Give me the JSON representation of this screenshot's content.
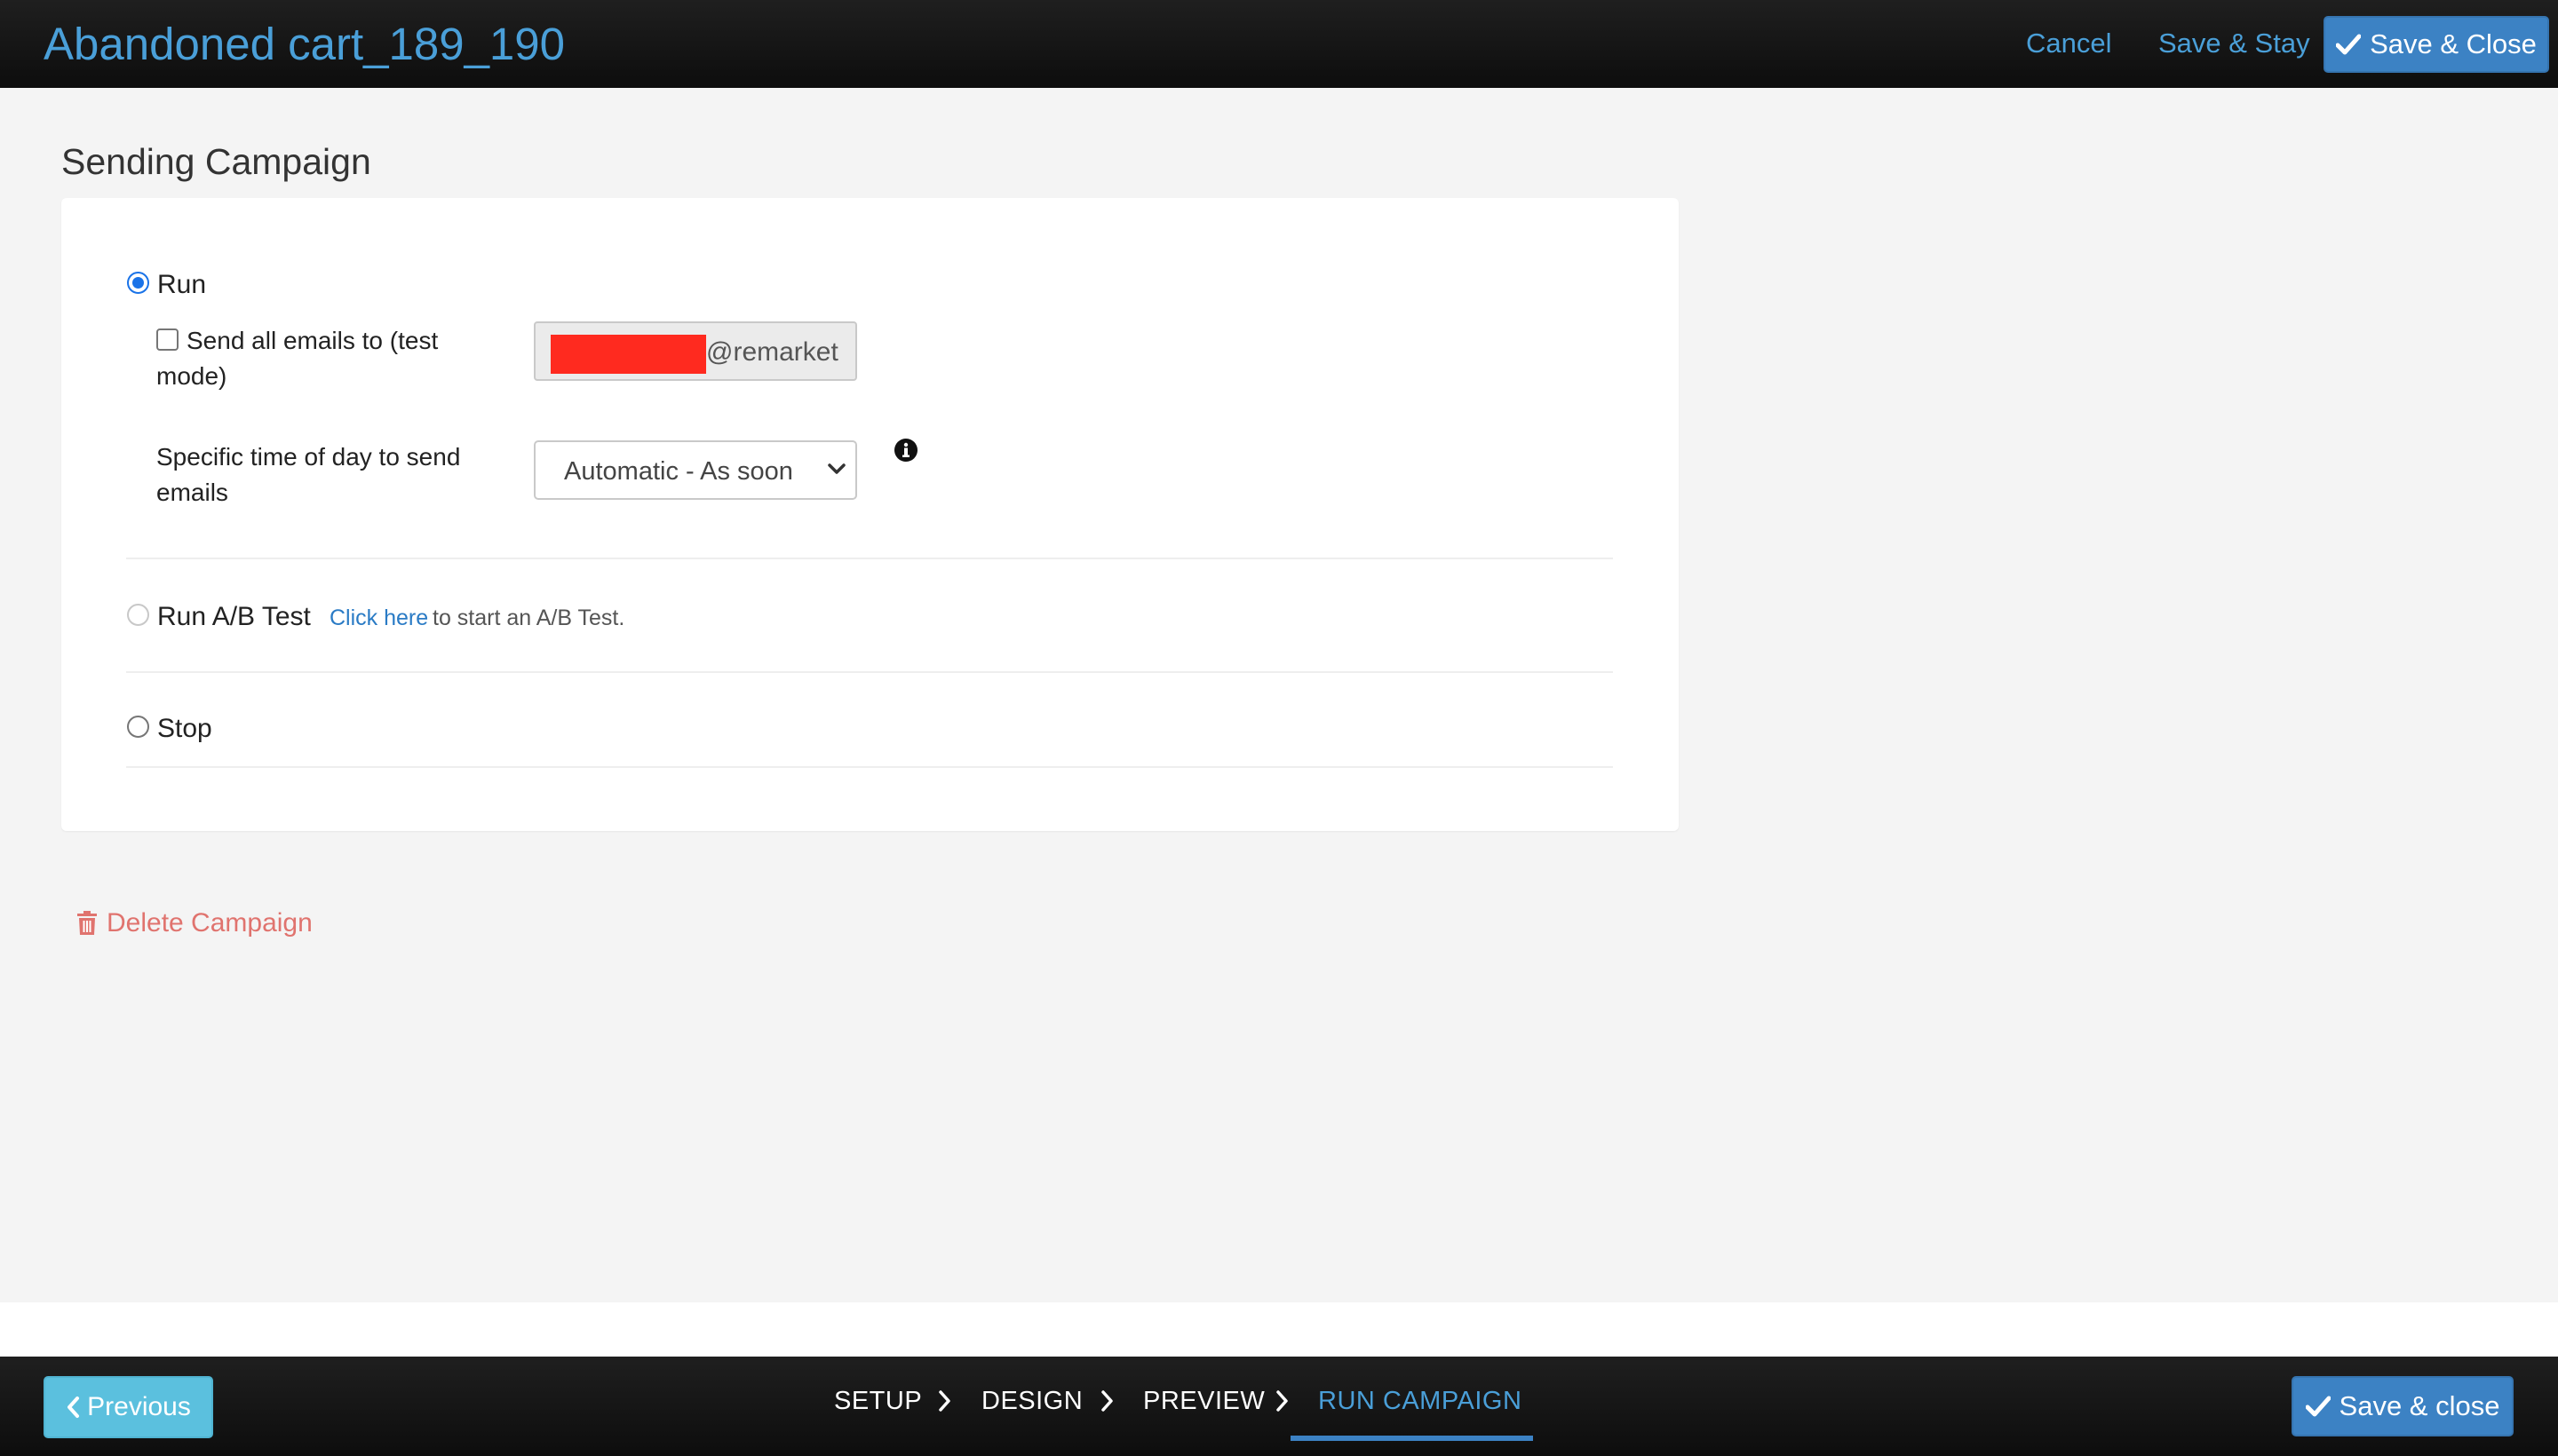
{
  "header": {
    "title": "Abandoned cart_189_190",
    "cancel_label": "Cancel",
    "save_stay_label": "Save & Stay",
    "save_close_label": "Save & Close"
  },
  "section_title": "Sending Campaign",
  "options": {
    "run": {
      "label": "Run",
      "selected": true
    },
    "test_mode": {
      "label": "Send all emails to (test mode)",
      "checked": false,
      "email_visible": "@remarket"
    },
    "send_time": {
      "label": "Specific time of day to send emails",
      "selected_value": "Automatic - As soon a"
    },
    "ab_test": {
      "label": "Run A/B Test",
      "link_text": "Click here",
      "rest_text": "to start an A/B Test."
    },
    "stop": {
      "label": "Stop",
      "selected": false
    }
  },
  "delete_label": "Delete Campaign",
  "footer": {
    "previous_label": "Previous",
    "save_close_label": "Save & close",
    "steps": [
      "SETUP",
      "DESIGN",
      "PREVIEW",
      "RUN CAMPAIGN"
    ],
    "active_step": "RUN CAMPAIGN"
  },
  "colors": {
    "accent": "#4a9fd8",
    "primary_button": "#3c82c4",
    "previous_button": "#5bc0de",
    "delete": "#e0736e",
    "radio_selected": "#1a73e8",
    "redaction": "#ff2a1f"
  },
  "icons": {
    "check": "check-icon",
    "info": "info-icon",
    "trash": "trash-icon",
    "chevron_left": "chevron-left-icon",
    "chevron_right": "chevron-right-icon",
    "chevron_down": "chevron-down-icon"
  }
}
